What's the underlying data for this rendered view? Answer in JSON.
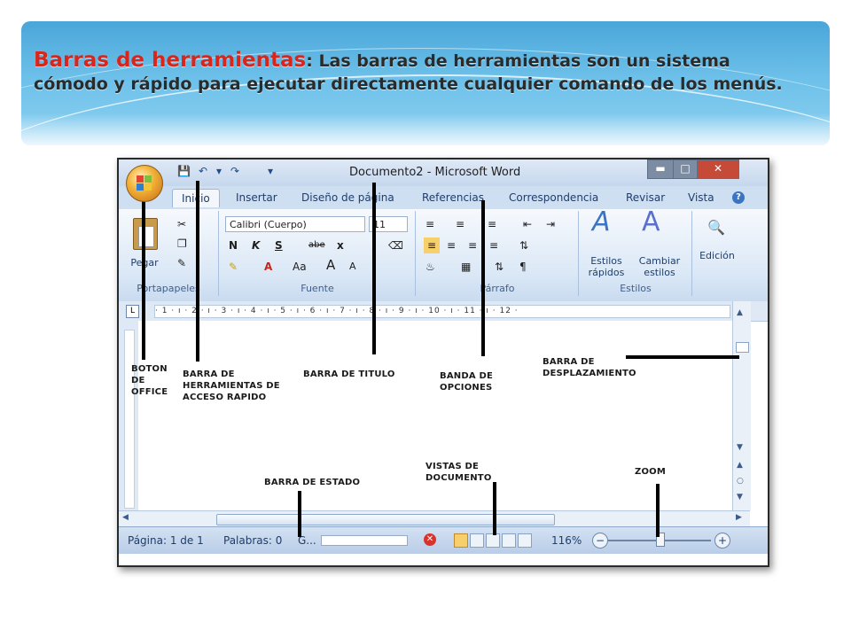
{
  "slide": {
    "heading": "Barras de herramientas",
    "text": ": Las barras de herramientas son un sistema cómodo y rápido para ejecutar directamente cualquier comando de los menús."
  },
  "window": {
    "title": "Documento2 - Microsoft Word",
    "min_icon": "minimize-icon",
    "max_icon": "maximize-icon",
    "close_icon": "close-icon"
  },
  "tabs": [
    "Inicio",
    "Insertar",
    "Diseño de página",
    "Referencias",
    "Correspondencia",
    "Revisar",
    "Vista"
  ],
  "ribbon": {
    "clipboard": {
      "label": "Portapapeles",
      "paste": "Pegar"
    },
    "font": {
      "label": "Fuente",
      "font_name": "Calibri (Cuerpo)",
      "font_size": "11",
      "bold": "N",
      "italic": "K",
      "underline": "S",
      "strike": "abe",
      "subscript": "x",
      "grow": "A",
      "shrink": "A",
      "case": "Aa"
    },
    "paragraph": {
      "label": "Párrafo",
      "pilcrow": "¶"
    },
    "styles": {
      "label": "Estilos",
      "quick": "Estilos rápidos",
      "change": "Cambiar estilos"
    },
    "editing": {
      "label": "Edición"
    }
  },
  "ruler": {
    "ticks": "· 1 · ı · 2 · ı · 3 · ı · 4 · ı · 5 · ı · 6 · ı · 7 · ı · 8 · ı · 9 · ı · 10 · ı · 11 · ı · 12 ·"
  },
  "status": {
    "page": "Página: 1 de 1",
    "words": "Palabras: 0",
    "lang": "G...",
    "zoom": "116%"
  },
  "annotations": {
    "office": "BOTON DE OFFICE",
    "qa": "BARRA DE HERRAMIENTAS DE ACCESO RAPIDO",
    "title": "BARRA DE TITULO",
    "options": "BANDA DE OPCIONES",
    "scroll": "BARRA DE DESPLAZAMIENTO",
    "status": "BARRA DE ESTADO",
    "views": "VISTAS DE DOCUMENTO",
    "zoom": "ZOOM"
  },
  "colors": {
    "heading": "#d8261c",
    "banner": "#4aa6d9",
    "ribbon": "#dbe8f6"
  }
}
